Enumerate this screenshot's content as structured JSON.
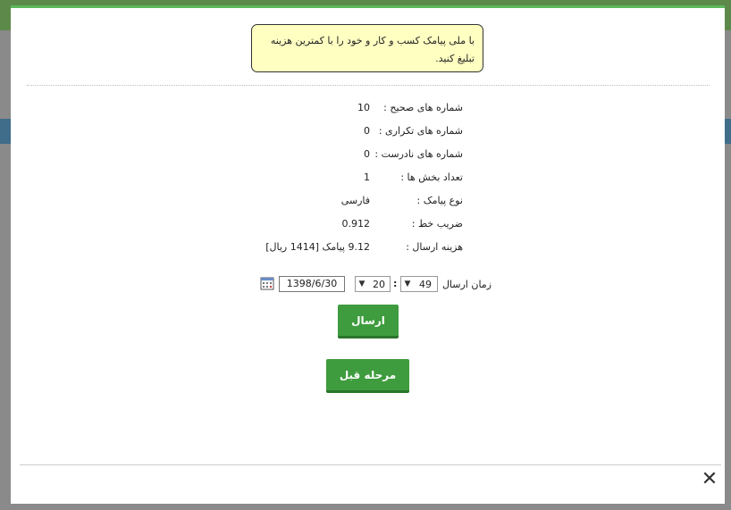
{
  "promo_message": "با ملی پیامک کسب و کار و خود را با کمترین هزینه تبلیغ کنید.",
  "summary": [
    {
      "label": "شماره های صحیح :",
      "value": "10"
    },
    {
      "label": "شماره های تکراری :",
      "value": "0"
    },
    {
      "label": "شماره های نادرست :",
      "value": "0"
    },
    {
      "label": "تعداد بخش ها :",
      "value": "1"
    },
    {
      "label": "نوع پیامک :",
      "value": "فارسی"
    },
    {
      "label": "ضریب خط :",
      "value": "0.912"
    },
    {
      "label": "هزینه ارسال :",
      "value": "9.12 پیامک [1414 ریال]"
    }
  ],
  "send_time": {
    "label": "زمان ارسال",
    "minute": "49",
    "hour": "20",
    "separator": ":",
    "date": "1398/6/30"
  },
  "buttons": {
    "send": "ارسال",
    "previous": "مرحله قبل"
  },
  "icons": {
    "calendar": "calendar-icon",
    "close": "close-icon",
    "chevron": "chevron-down-icon"
  },
  "colors": {
    "button_green": "#3e9c3e",
    "promo_bg": "#ffffc2",
    "accent_green": "#5cb85c"
  }
}
